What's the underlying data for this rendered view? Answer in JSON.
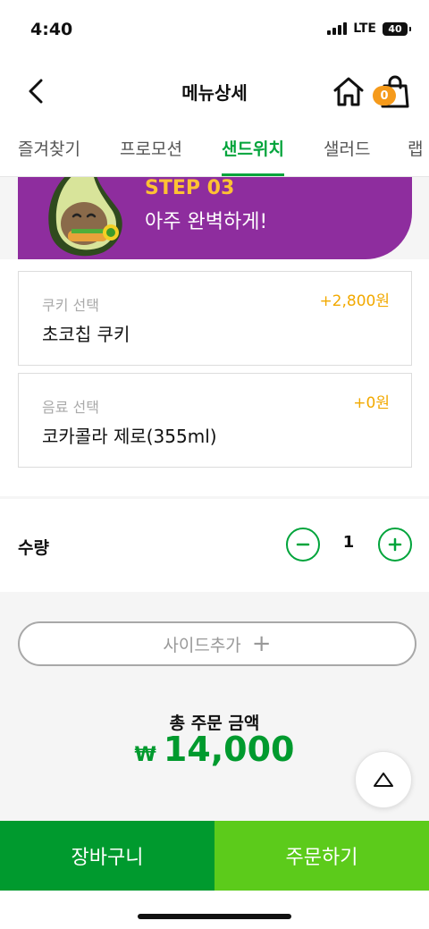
{
  "status_bar": {
    "time": "4:40",
    "network": "LTE",
    "battery": "40"
  },
  "header": {
    "title": "메뉴상세",
    "cart_count": "0"
  },
  "tabs": [
    {
      "label": "즐겨찾기",
      "active": false
    },
    {
      "label": "프로모션",
      "active": false
    },
    {
      "label": "샌드위치",
      "active": true
    },
    {
      "label": "샐러드",
      "active": false
    },
    {
      "label": "랩",
      "active": false
    }
  ],
  "step": {
    "label": "STEP 03",
    "description": "아주 완벽하게!"
  },
  "options": [
    {
      "label": "쿠키 선택",
      "value": "초코칩 쿠키",
      "price": "+2,800원"
    },
    {
      "label": "음료 선택",
      "value": "코카콜라 제로(355ml)",
      "price": "+0원"
    }
  ],
  "quantity": {
    "label": "수량",
    "value": "1"
  },
  "side_add": {
    "label": "사이드추가",
    "plus": "+"
  },
  "total": {
    "label": "총 주문 금액",
    "currency": "₩",
    "amount": "14,000"
  },
  "actions": {
    "cart": "장바구니",
    "order": "주문하기"
  },
  "colors": {
    "primary_green": "#009a2e",
    "light_green": "#5ccb1b",
    "step_purple": "#8e2d9e",
    "step_yellow": "#ffc233",
    "price_orange": "#f2a900",
    "badge_orange": "#f59a1b"
  }
}
